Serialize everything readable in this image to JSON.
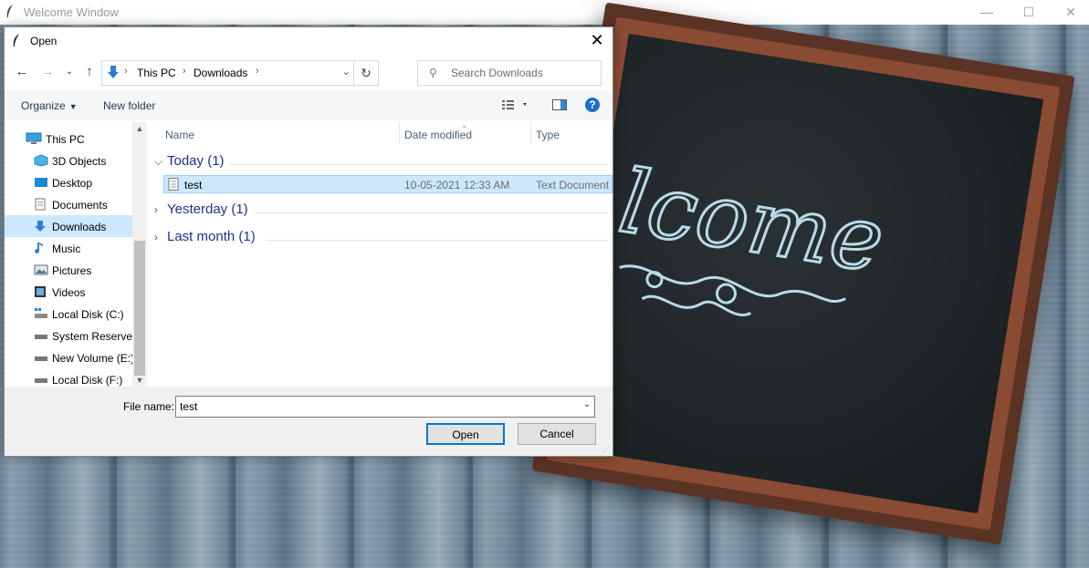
{
  "main_window": {
    "title": "Welcome Window",
    "chalkboard_text": "lcome"
  },
  "dialog": {
    "title": "Open",
    "breadcrumb": [
      "This PC",
      "Downloads"
    ],
    "search_placeholder": "Search Downloads",
    "toolbar": {
      "organize_label": "Organize",
      "new_folder_label": "New folder"
    },
    "nav_items": [
      {
        "label": "This PC",
        "icon": "computer-icon"
      },
      {
        "label": "3D Objects",
        "icon": "cube-icon"
      },
      {
        "label": "Desktop",
        "icon": "desktop-icon"
      },
      {
        "label": "Documents",
        "icon": "document-icon"
      },
      {
        "label": "Downloads",
        "icon": "download-icon"
      },
      {
        "label": "Music",
        "icon": "music-icon"
      },
      {
        "label": "Pictures",
        "icon": "pictures-icon"
      },
      {
        "label": "Videos",
        "icon": "videos-icon"
      },
      {
        "label": "Local Disk (C:)",
        "icon": "drive-icon"
      },
      {
        "label": "System Reserved",
        "icon": "drive-icon"
      },
      {
        "label": "New Volume (E:)",
        "icon": "drive-icon"
      },
      {
        "label": "Local Disk (F:)",
        "icon": "drive-icon"
      }
    ],
    "columns": [
      "Name",
      "Date modified",
      "Type"
    ],
    "groups": [
      {
        "label": "Today (1)",
        "expanded": true
      },
      {
        "label": "Yesterday (1)",
        "expanded": false
      },
      {
        "label": "Last month (1)",
        "expanded": false
      }
    ],
    "selected_file": {
      "name": "test",
      "date_modified": "10-05-2021 12:33 AM",
      "type": "Text Document"
    },
    "file_name_label": "File name:",
    "file_name_value": "test",
    "open_label": "Open",
    "cancel_label": "Cancel"
  }
}
